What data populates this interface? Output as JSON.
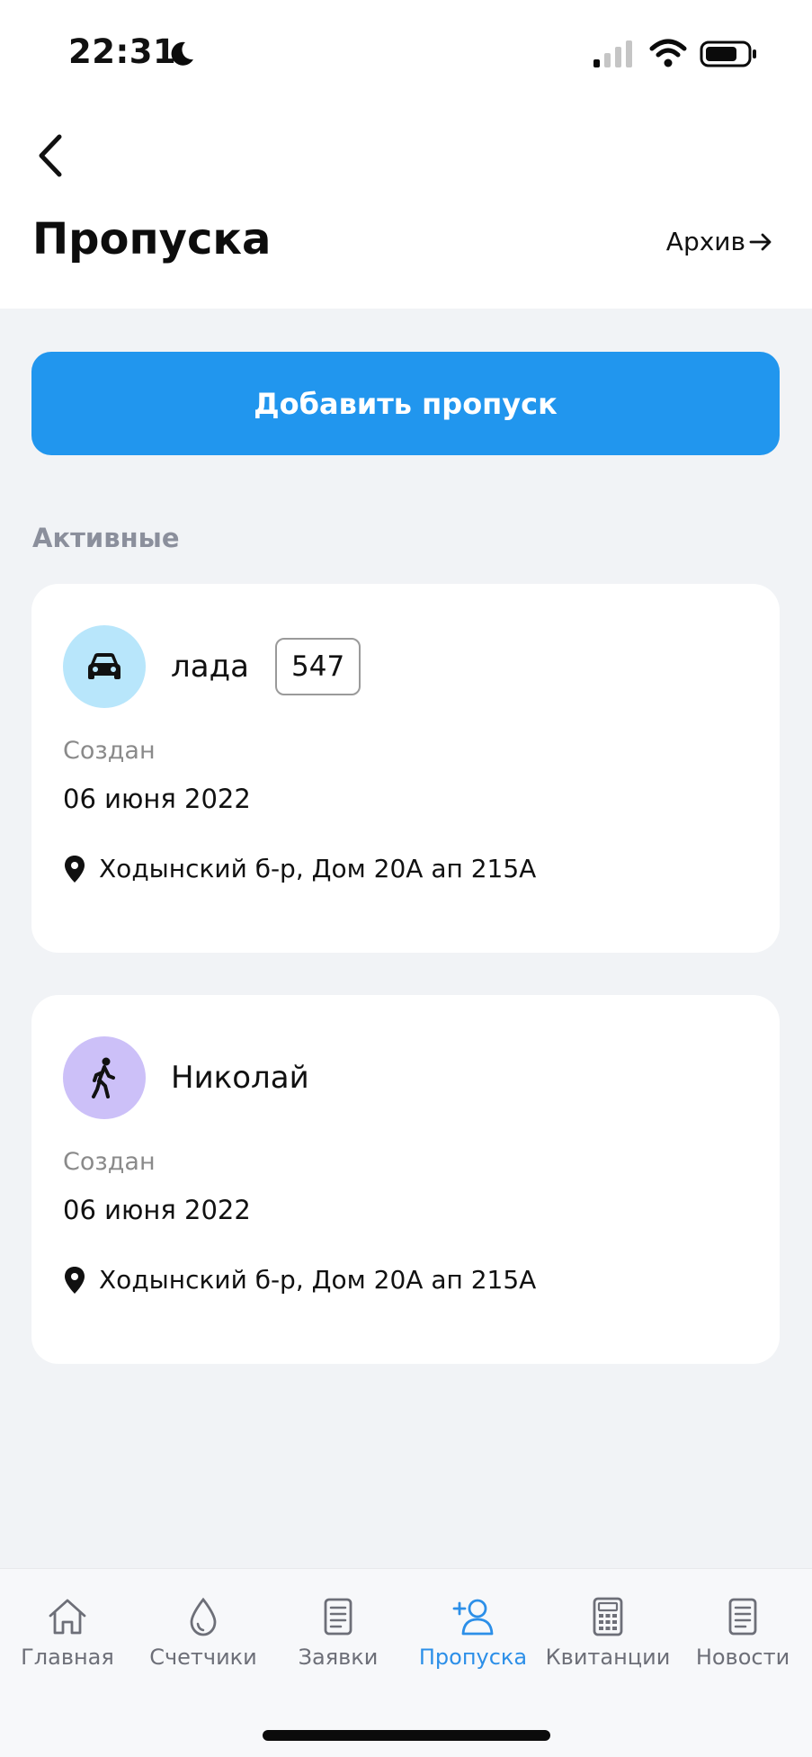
{
  "status_bar": {
    "time": "22:31"
  },
  "header": {
    "title": "Пропуска",
    "archive_label": "Архив"
  },
  "add_button_label": "Добавить пропуск",
  "section_label": "Активные",
  "passes": [
    {
      "type": "car",
      "icon": "car-icon",
      "name": "лада",
      "plate": "547",
      "created_label": "Создан",
      "created_date": "06 июня 2022",
      "address": "Ходынский б-р, Дом 20А ап 215А"
    },
    {
      "type": "pedestrian",
      "icon": "walking-person-icon",
      "name": "Николай",
      "created_label": "Создан",
      "created_date": "06 июня 2022",
      "address": "Ходынский б-р, Дом 20А ап 215А"
    }
  ],
  "tabbar": {
    "active_color": "#2c8fe8",
    "items": [
      {
        "label": "Главная",
        "icon": "home-icon"
      },
      {
        "label": "Счетчики",
        "icon": "water-drop-icon"
      },
      {
        "label": "Заявки",
        "icon": "document-icon"
      },
      {
        "label": "Пропуска",
        "icon": "add-user-icon",
        "active": true
      },
      {
        "label": "Квитанции",
        "icon": "calculator-icon"
      },
      {
        "label": "Новости",
        "icon": "news-icon"
      }
    ]
  }
}
